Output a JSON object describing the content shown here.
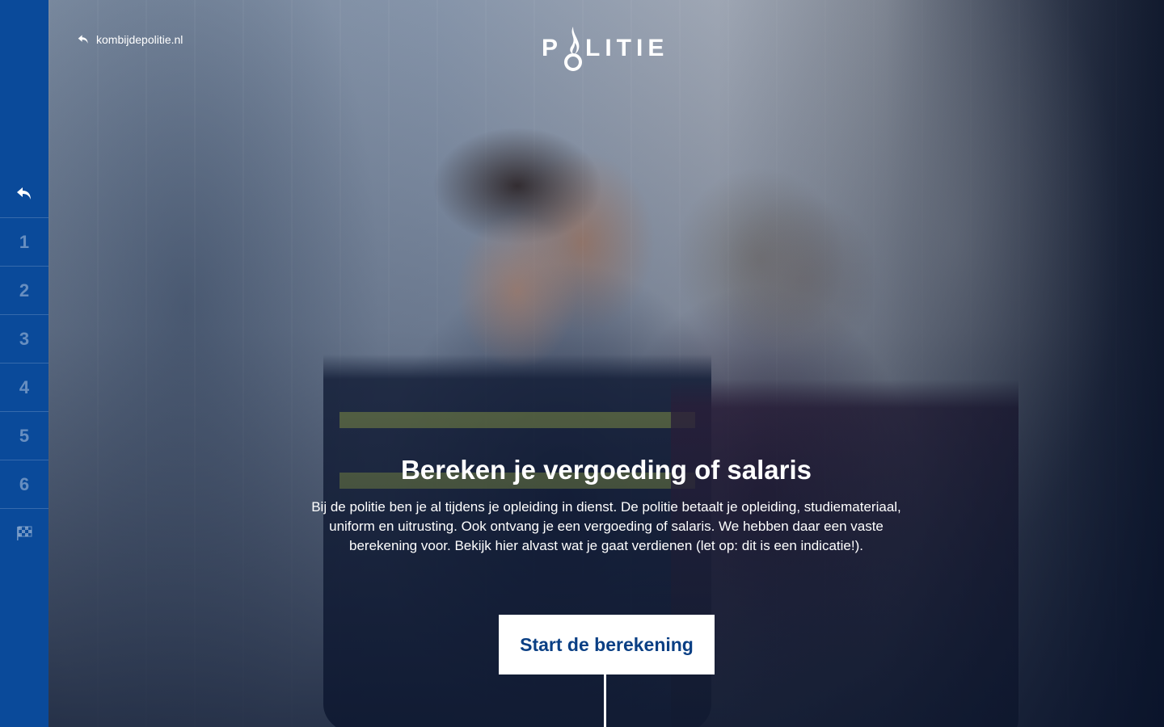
{
  "header": {
    "back_link_label": "kombijdepolitie.nl",
    "logo_text_first": "P",
    "logo_text_rest": "LITIE"
  },
  "sidebar": {
    "steps": [
      {
        "label": "1"
      },
      {
        "label": "2"
      },
      {
        "label": "3"
      },
      {
        "label": "4"
      },
      {
        "label": "5"
      },
      {
        "label": "6"
      }
    ]
  },
  "main": {
    "title": "Bereken je vergoeding of salaris",
    "intro": "Bij de politie ben je al tijdens je opleiding in dienst. De politie betaalt je opleiding, studiemateriaal, uniform en uitrusting. Ook ontvang je een vergoeding of salaris. We hebben daar een vaste berekening voor. Bekijk hier alvast wat je gaat verdienen (let op: dit is een indicatie!).",
    "cta_label": "Start de berekening"
  },
  "colors": {
    "sidebar": "#0a4a9a",
    "cta_text": "#0a3f84",
    "cta_background": "#ffffff"
  }
}
